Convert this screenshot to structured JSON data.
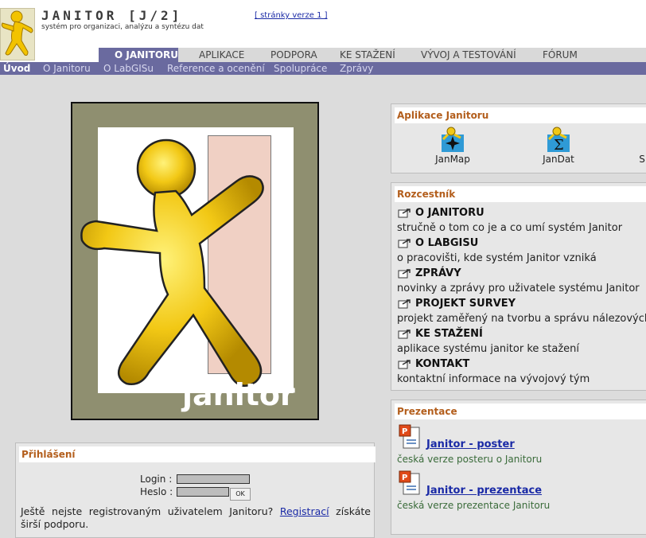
{
  "header": {
    "title": "JANITOR [J/2]",
    "subtitle": "systém pro organizaci, analýzu a syntézu dat",
    "version_link": "[ stránky verze 1 ]"
  },
  "main_menu": [
    {
      "label": "O JANITORU",
      "active": true
    },
    {
      "label": "APLIKACE"
    },
    {
      "label": "PODPORA"
    },
    {
      "label": "KE STAŽENÍ"
    },
    {
      "label": "VÝVOJ A TESTOVÁNÍ"
    },
    {
      "label": "FÓRUM"
    }
  ],
  "sub_menu": [
    {
      "label": "Úvod",
      "active": true
    },
    {
      "label": "O Janitoru"
    },
    {
      "label": "O LabGISu"
    },
    {
      "label": "Reference a ocenění"
    },
    {
      "label": "Spolupráce"
    },
    {
      "label": "Zprávy"
    }
  ],
  "hero": {
    "logo_text": "janitor"
  },
  "login": {
    "title": "Přihlášení",
    "login_label": "Login :",
    "password_label": "Heslo :",
    "ok_label": "OK",
    "note_prefix": "Ještě nejste registrovaným uživatelem Janitoru?",
    "register_link": "Registrací",
    "note_suffix": "získáte širší podporu."
  },
  "apps": {
    "title": "Aplikace Janitoru",
    "items": [
      {
        "label": "JanMap",
        "icon": "janmap-icon"
      },
      {
        "label": "JanDat",
        "icon": "jandat-icon"
      },
      {
        "label": "S",
        "icon": "partial-app-icon"
      }
    ]
  },
  "crossroads": {
    "title": "Rozcestník",
    "items": [
      {
        "title": "O JANITORU",
        "desc": "stručně o tom co je a co umí systém Janitor"
      },
      {
        "title": "O LABGISU",
        "desc": "o pracovišti, kde systém Janitor vzniká"
      },
      {
        "title": "ZPRÁVY",
        "desc": "novinky a zprávy pro uživatele systému Janitor"
      },
      {
        "title": "PROJEKT SURVEY",
        "desc": "projekt zaměřený na tvorbu a správu nálezových"
      },
      {
        "title": "KE STAŽENÍ",
        "desc": "aplikace systému janitor ke stažení"
      },
      {
        "title": "KONTAKT",
        "desc": "kontaktní informace na vývojový tým"
      }
    ]
  },
  "presentations": {
    "title": "Prezentace",
    "items": [
      {
        "title": "Janitor - poster",
        "desc": "česká verze posteru o Janitoru"
      },
      {
        "title": "Janitor - prezentace",
        "desc": "česká verze prezentace Janitoru"
      }
    ]
  },
  "colors": {
    "menu_active": "#6a6a9f",
    "panel_title": "#b35e1c",
    "link": "#1a2aa6"
  }
}
